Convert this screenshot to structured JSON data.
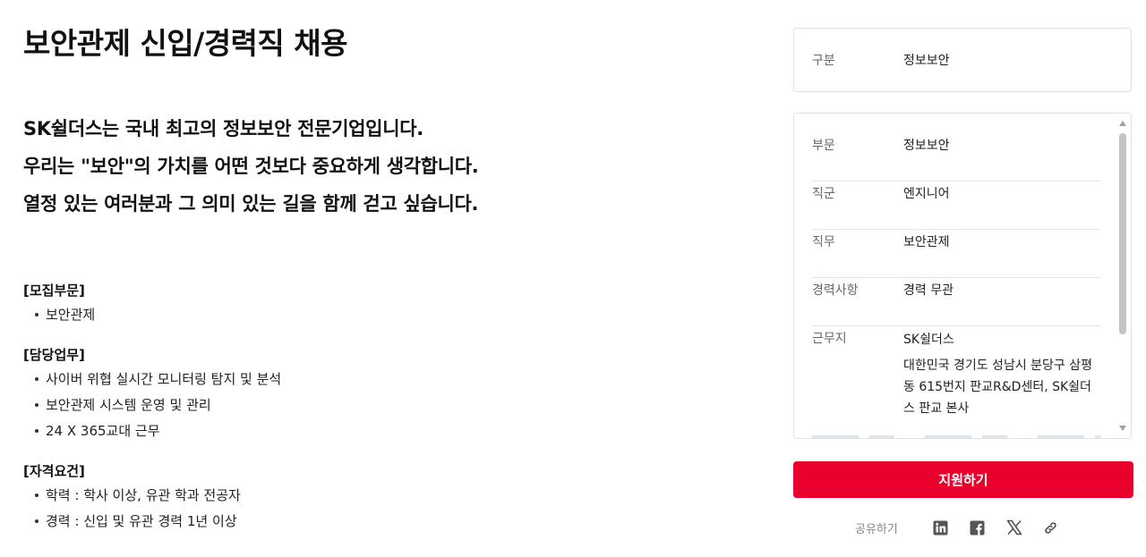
{
  "title": "보안관제 신입/경력직 채용",
  "intro": [
    "SK쉴더스는 국내 최고의 정보보안 전문기업입니다.",
    "우리는 \"보안\"의 가치를 어떤 것보다 중요하게 생각합니다.",
    "열정 있는 여러분과 그 의미 있는 길을 함께 걷고 싶습니다."
  ],
  "sections": [
    {
      "heading": "[모집부문]",
      "items": [
        "보안관제"
      ]
    },
    {
      "heading": "[담당업무]",
      "items": [
        "사이버 위협 실시간 모니터링 탐지 및 분석",
        "보안관제 시스템 운영 및 관리",
        "24 X 365교대 근무"
      ]
    },
    {
      "heading": "[자격요건]",
      "items": [
        "학력 : 학사 이상, 유관 학과 전공자",
        "경력 : 신입 및 유관 경력 1년 이상"
      ]
    }
  ],
  "summary": {
    "label": "구분",
    "value": "정보보안"
  },
  "details": [
    {
      "label": "부문",
      "value": "정보보안"
    },
    {
      "label": "직군",
      "value": "엔지니어"
    },
    {
      "label": "직무",
      "value": "보안관제"
    },
    {
      "label": "경력사항",
      "value": "경력 무관"
    }
  ],
  "location": {
    "label": "근무지",
    "company": "SK쉴더스",
    "address": "대한민국 경기도 성남시 분당구 삼평동 615번지 판교R&D센터, SK쉴더스 판교 본사"
  },
  "apply_label": "지원하기",
  "share_label": "공유하기",
  "share_icons": [
    "linkedin-icon",
    "facebook-icon",
    "x-icon",
    "link-icon"
  ],
  "colors": {
    "accent": "#ea002c"
  }
}
